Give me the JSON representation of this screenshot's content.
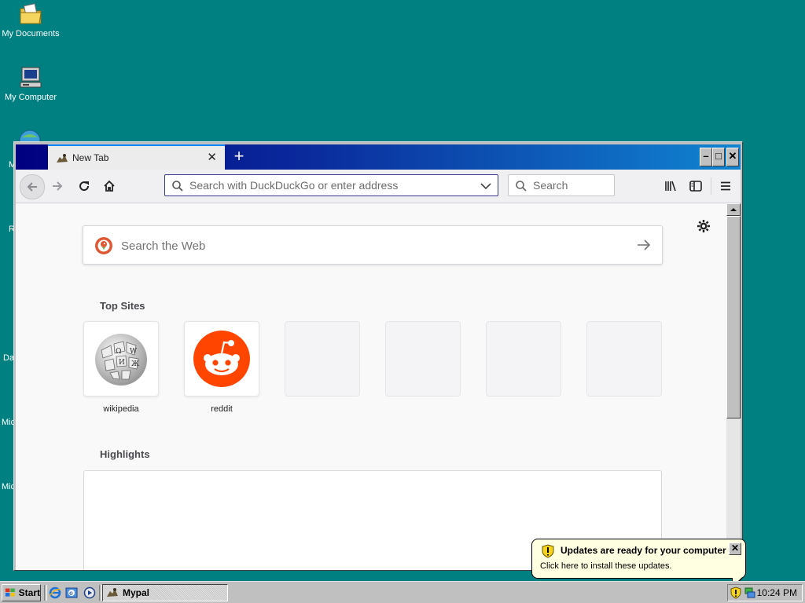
{
  "desktop": {
    "icons": [
      {
        "label": "My Documents"
      },
      {
        "label": "My Computer"
      }
    ],
    "partial_labels": [
      "M",
      "R",
      "Da",
      "Mic",
      "Mic"
    ]
  },
  "browser": {
    "tab_title": "New Tab",
    "tab_close": "✕",
    "new_tab": "+",
    "window_buttons": {
      "minimize": "–",
      "maximize": "□",
      "close": "✕"
    },
    "url_placeholder": "Search with DuckDuckGo or enter address",
    "search_placeholder": "Search",
    "content": {
      "web_search_placeholder": "Search the Web",
      "top_sites_title": "Top Sites",
      "top_sites": [
        {
          "name": "wikipedia",
          "icon": "wikipedia-globe-icon"
        },
        {
          "name": "reddit",
          "icon": "reddit-alien-icon"
        },
        {
          "name": "",
          "icon": ""
        },
        {
          "name": "",
          "icon": ""
        },
        {
          "name": "",
          "icon": ""
        },
        {
          "name": "",
          "icon": ""
        }
      ],
      "highlights_title": "Highlights"
    }
  },
  "taskbar": {
    "start_label": "Start",
    "task_label": "Mypal",
    "clock": "10:24 PM"
  },
  "balloon": {
    "title": "Updates are ready for your computer",
    "text": "Click here to install these updates.",
    "close": "✕"
  },
  "colors": {
    "desktop": "#008080",
    "titlebar_start": "#000080",
    "titlebar_end": "#1084d0",
    "reddit": "#ff4500",
    "balloon": "#ffffe1"
  }
}
